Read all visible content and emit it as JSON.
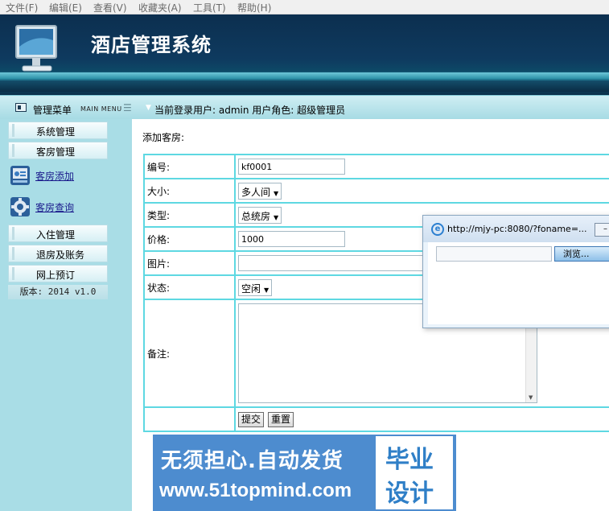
{
  "browser_menu": [
    "文件(F)",
    "编辑(E)",
    "查看(V)",
    "收藏夹(A)",
    "工具(T)",
    "帮助(H)"
  ],
  "app": {
    "title": "酒店管理系统"
  },
  "toolbar": {
    "menu_title": "管理菜单",
    "menu_sub": "MAIN MENU",
    "user_label": "当前登录用户: admin  用户角色: 超级管理员"
  },
  "sidebar": {
    "items": [
      {
        "label": "系统管理"
      },
      {
        "label": "客房管理"
      }
    ],
    "sub_links": [
      {
        "label": "客房添加"
      },
      {
        "label": "客房查询"
      }
    ],
    "items2": [
      {
        "label": "入住管理"
      },
      {
        "label": "退房及账务"
      },
      {
        "label": "网上预订"
      }
    ],
    "version": "版本: 2014 v1.0"
  },
  "form": {
    "heading": "添加客房:",
    "fields": {
      "id_label": "编号:",
      "id_value": "kf0001",
      "size_label": "大小:",
      "size_value": "多人间",
      "type_label": "类型:",
      "type_value": "总统房",
      "price_label": "价格:",
      "price_value": "1000",
      "image_label": "图片:",
      "status_label": "状态:",
      "status_value": "空闲",
      "remark_label": "备注:"
    },
    "submit": "提交",
    "reset": "重置"
  },
  "popup": {
    "url": "http://mjy-pc:8080/?foname=...",
    "browse": "浏览..."
  },
  "ad": {
    "line1": "无须担心.自动发货",
    "line2": "www.51topmind.com",
    "box1": "毕业",
    "box2": "设计"
  }
}
